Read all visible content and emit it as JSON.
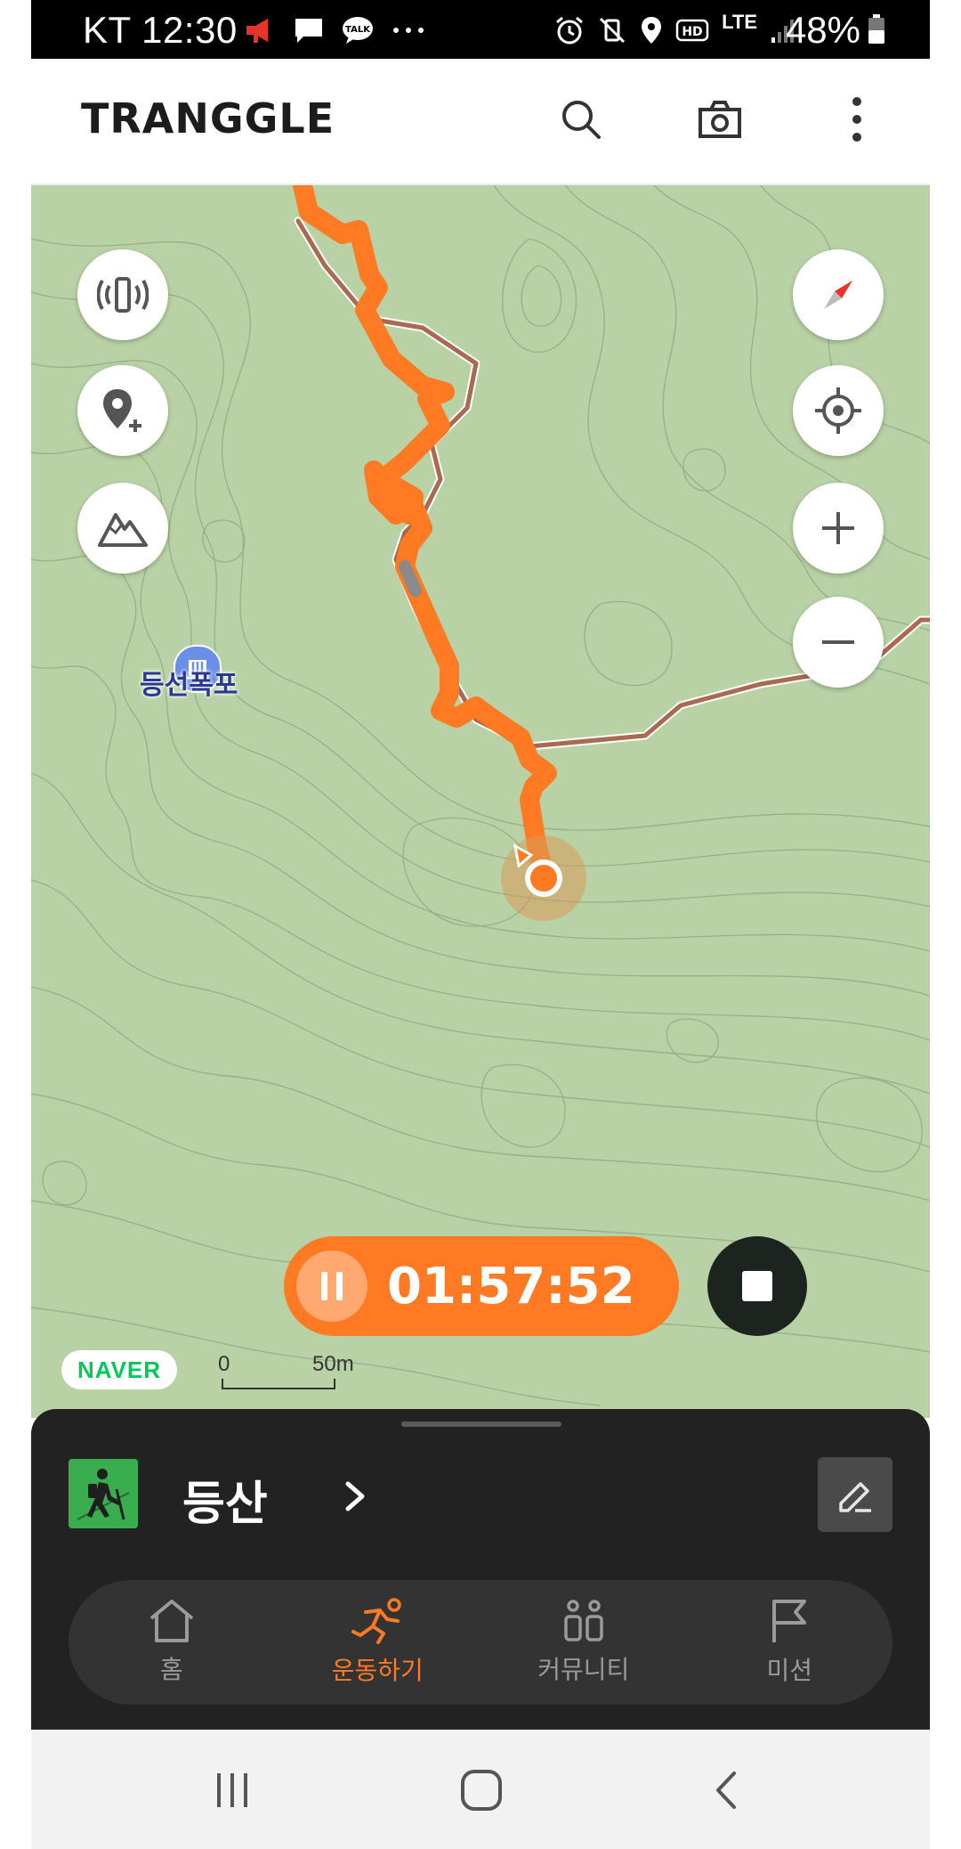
{
  "status_bar": {
    "carrier_time": "KT 12:30",
    "battery": "48%",
    "network": "LTE"
  },
  "header": {
    "logo": "TRANGGLE",
    "icons": [
      "search-icon",
      "camera-icon",
      "more-icon"
    ]
  },
  "map": {
    "poi_label": "등선폭포",
    "attribution": "NAVER",
    "scale_start": "0",
    "scale_end": "50m",
    "route_color": "#ff7a22",
    "trail_color": "#a86a50",
    "map_color": "#b9d2a5"
  },
  "recording": {
    "elapsed": "01:57:52"
  },
  "activity": {
    "label": "등산"
  },
  "bottom_nav": {
    "items": [
      {
        "label": "홈",
        "icon": "home-icon"
      },
      {
        "label": "운동하기",
        "icon": "running-icon",
        "active": true
      },
      {
        "label": "커뮤니티",
        "icon": "community-icon"
      },
      {
        "label": "미션",
        "icon": "flag-icon"
      }
    ]
  }
}
